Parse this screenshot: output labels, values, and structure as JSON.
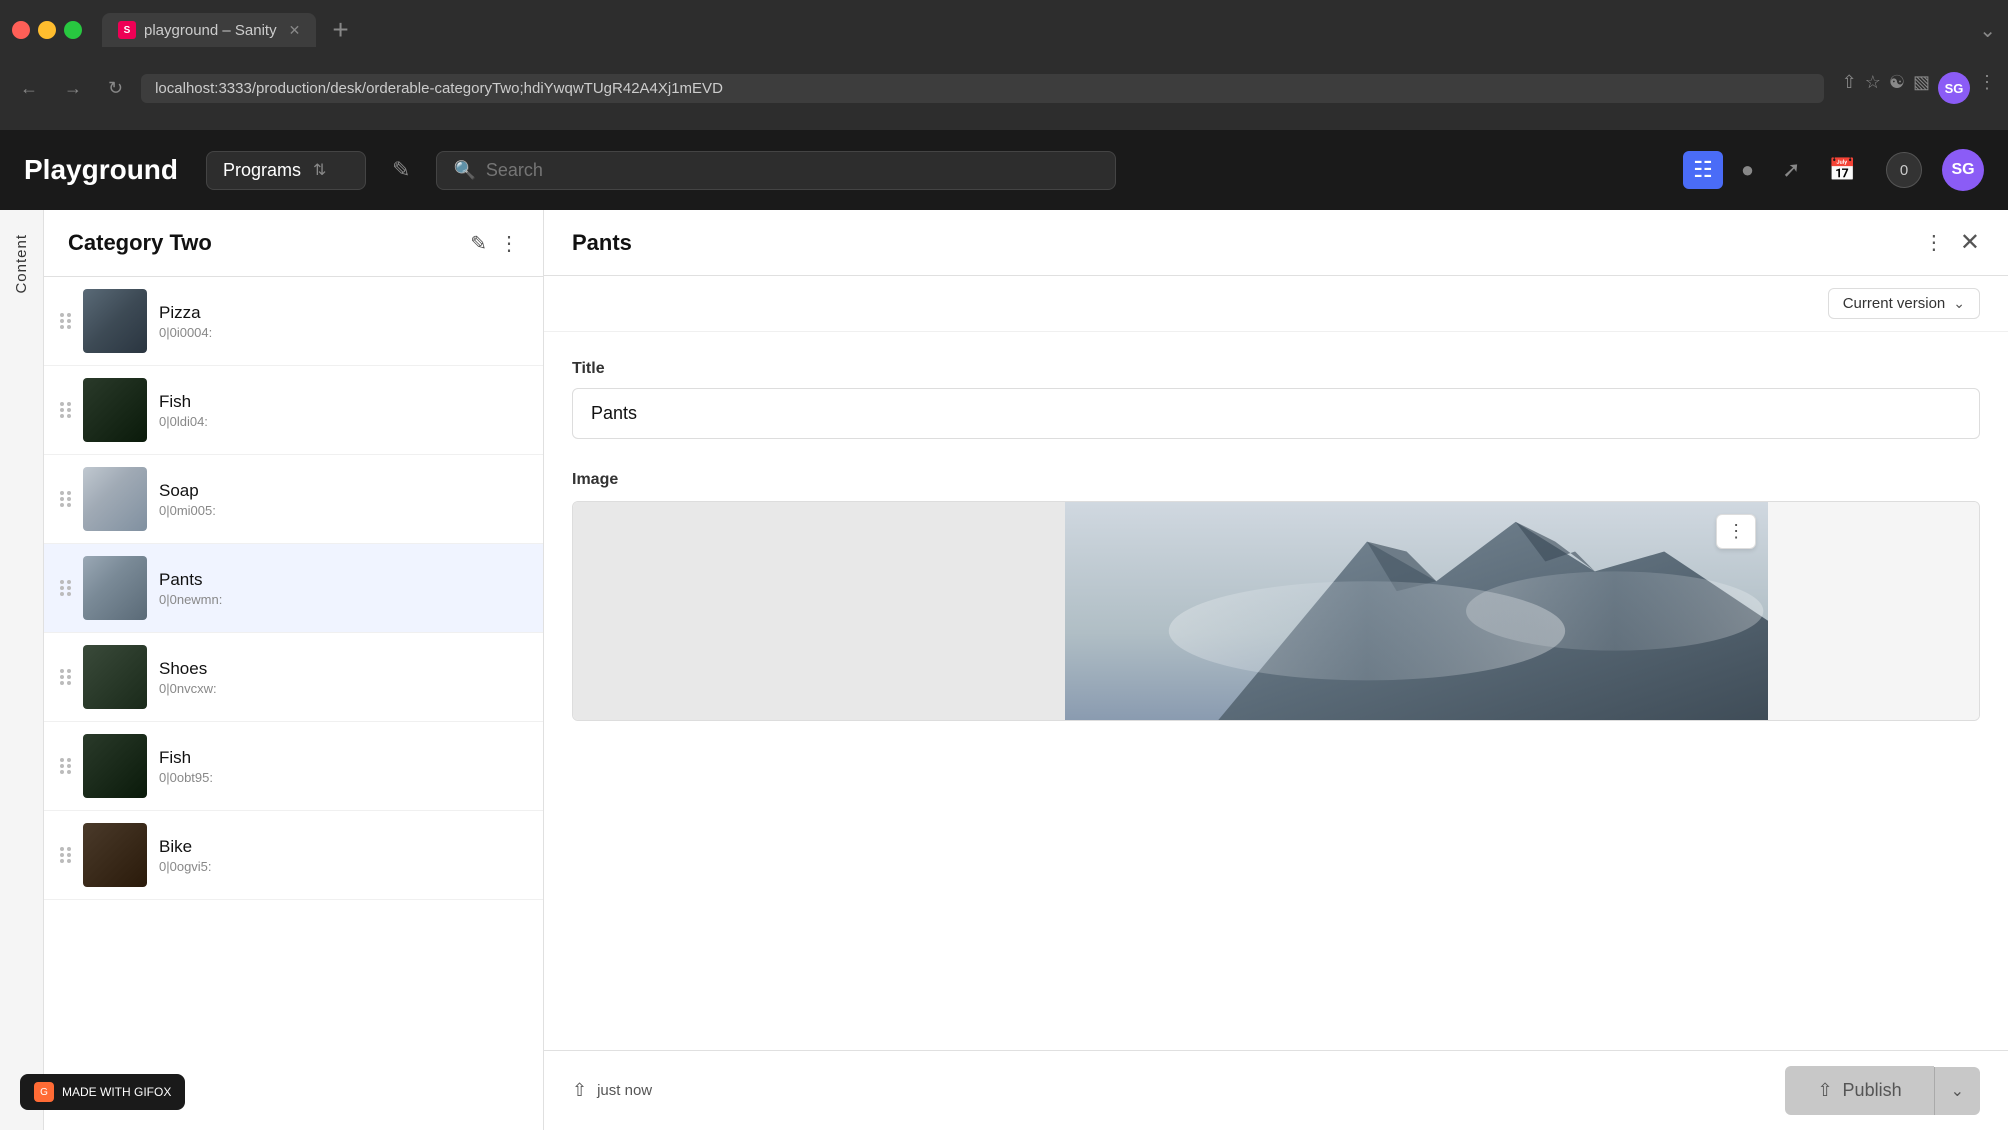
{
  "browser": {
    "tab_title": "playground – Sanity",
    "tab_favicon": "S",
    "url": "localhost:3333/production/desk/orderable-categoryTwo;hdiYwqwTUgR42A4Xj1mEVD",
    "user_initials": "SG"
  },
  "topnav": {
    "app_title": "Playground",
    "programs_label": "Programs",
    "search_placeholder": "Search",
    "notif_count": "0",
    "user_initials": "SG"
  },
  "left_panel": {
    "title": "Category Two",
    "items": [
      {
        "name": "Pizza",
        "id": "0|0i0004:",
        "thumb_class": "mountain-dark"
      },
      {
        "name": "Fish",
        "id": "0|0ldi04:",
        "thumb_class": "mountain-forest"
      },
      {
        "name": "Soap",
        "id": "0|0mi005:",
        "thumb_class": "mountain-snowy"
      },
      {
        "name": "Pants",
        "id": "0|0newmn:",
        "thumb_class": "mountain-pants",
        "active": true
      },
      {
        "name": "Shoes",
        "id": "0|0nvcxw:",
        "thumb_class": "mountain-forest"
      },
      {
        "name": "Fish",
        "id": "0|0obt95:",
        "thumb_class": "mountain-dark"
      },
      {
        "name": "Bike",
        "id": "0|0ogvi5:",
        "thumb_class": "mountain-dark"
      }
    ]
  },
  "right_panel": {
    "title": "Pants",
    "version_label": "Current version",
    "title_field_label": "Title",
    "title_field_value": "Pants",
    "image_field_label": "Image",
    "save_status": "just now",
    "publish_label": "Publish"
  },
  "sidebar": {
    "tab_label": "Content"
  }
}
